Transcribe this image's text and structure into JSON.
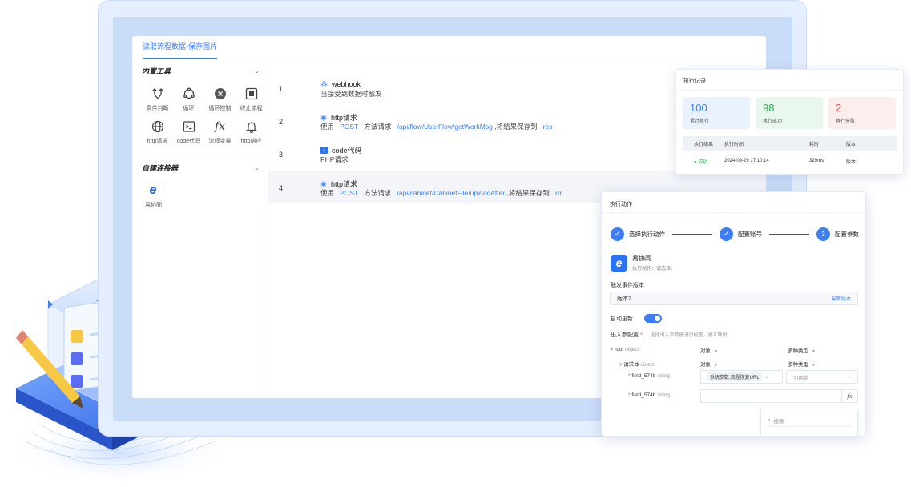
{
  "window": {
    "tab": "读取流程数据-保存图片"
  },
  "sidebar": {
    "builtin_title": "内置工具",
    "tools": [
      {
        "label": "条件判断",
        "icon": "branch-icon"
      },
      {
        "label": "循环",
        "icon": "loop-icon"
      },
      {
        "label": "循环控制",
        "icon": "stop-circle-icon"
      },
      {
        "label": "终止流程",
        "icon": "terminate-icon"
      },
      {
        "label": "http请求",
        "icon": "globe-icon"
      },
      {
        "label": "code代码",
        "icon": "terminal-icon"
      },
      {
        "label": "流程变量",
        "icon": "fx-icon"
      },
      {
        "label": "http响应",
        "icon": "bell-icon"
      }
    ],
    "custom_title": "自建连接器",
    "connectors": [
      {
        "label": "易协同",
        "icon": "e-logo-icon"
      }
    ]
  },
  "flow": {
    "steps": [
      {
        "num": "1",
        "title": "webhook",
        "desc": "当接受到数据时触发"
      },
      {
        "num": "2",
        "title": "http请求",
        "desc_prefix": "使用",
        "method": "POST",
        "desc_mid": "方法请求",
        "path": "/api/flow/UserFlow/getWorkMsg",
        "desc_suffix": ",将结果保存到",
        "var": "res"
      },
      {
        "num": "3",
        "title": "code代码",
        "desc": "PHP请求"
      },
      {
        "num": "4",
        "title": "http请求",
        "desc_prefix": "使用",
        "method": "POST",
        "desc_mid": "方法请求",
        "path": "/api/cabinet/CabinetFile/uploadAfter",
        "desc_suffix": ",将结果保存到",
        "var": "rrr"
      }
    ]
  },
  "record": {
    "title": "执行记录",
    "stats": [
      {
        "value": "100",
        "label": "累计执行",
        "color": "#3d7ef5"
      },
      {
        "value": "98",
        "label": "执行成功",
        "color": "#2fae55"
      },
      {
        "value": "2",
        "label": "执行失败",
        "color": "#e34d4d"
      }
    ],
    "columns": [
      "执行结果",
      "执行时间",
      "耗时",
      "版本"
    ],
    "rows": [
      {
        "result": "成功",
        "time": "2024-09-29 17:10:14",
        "duration": "329ms",
        "version": "版本1"
      }
    ]
  },
  "action": {
    "title": "执行动作",
    "steps": [
      {
        "num": "✓",
        "label": "选择执行动作"
      },
      {
        "num": "✓",
        "label": "配置账号"
      },
      {
        "num": "3",
        "label": "配置参数"
      }
    ],
    "app_name": "易协同",
    "app_sub": "执行动作：请选择。",
    "version_label": "触发事件版本",
    "version_value": "版本2",
    "version_link": "最新版本",
    "auto_update_label": "自动更新",
    "auto_update_on": true,
    "io_label": "出入参配置",
    "io_hint": "选择出入参数据进行配置，建立映射",
    "tree": [
      {
        "name": "root",
        "type": "object",
        "kind": "对象",
        "multi": "多种类型"
      },
      {
        "name": "请求体",
        "type": "object",
        "kind": "对象",
        "multi": "多种类型"
      }
    ],
    "fields": [
      {
        "name": "field_574b",
        "type": "string",
        "value": "系统参数.流程恢复URL",
        "ref": "引用值"
      },
      {
        "name": "field_574b",
        "type": "string",
        "value": "",
        "fx": "fx"
      }
    ],
    "search_placeholder": "搜索"
  }
}
